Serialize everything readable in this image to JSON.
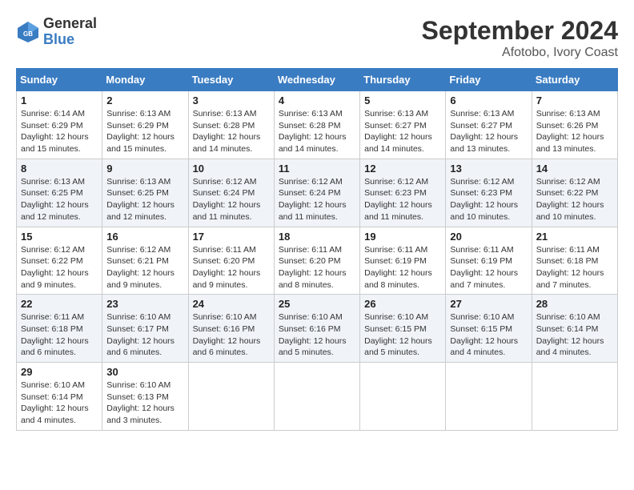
{
  "header": {
    "logo_line1": "General",
    "logo_line2": "Blue",
    "month": "September 2024",
    "location": "Afotobo, Ivory Coast"
  },
  "weekdays": [
    "Sunday",
    "Monday",
    "Tuesday",
    "Wednesday",
    "Thursday",
    "Friday",
    "Saturday"
  ],
  "weeks": [
    [
      {
        "day": "1",
        "info": "Sunrise: 6:14 AM\nSunset: 6:29 PM\nDaylight: 12 hours\nand 15 minutes."
      },
      {
        "day": "2",
        "info": "Sunrise: 6:13 AM\nSunset: 6:29 PM\nDaylight: 12 hours\nand 15 minutes."
      },
      {
        "day": "3",
        "info": "Sunrise: 6:13 AM\nSunset: 6:28 PM\nDaylight: 12 hours\nand 14 minutes."
      },
      {
        "day": "4",
        "info": "Sunrise: 6:13 AM\nSunset: 6:28 PM\nDaylight: 12 hours\nand 14 minutes."
      },
      {
        "day": "5",
        "info": "Sunrise: 6:13 AM\nSunset: 6:27 PM\nDaylight: 12 hours\nand 14 minutes."
      },
      {
        "day": "6",
        "info": "Sunrise: 6:13 AM\nSunset: 6:27 PM\nDaylight: 12 hours\nand 13 minutes."
      },
      {
        "day": "7",
        "info": "Sunrise: 6:13 AM\nSunset: 6:26 PM\nDaylight: 12 hours\nand 13 minutes."
      }
    ],
    [
      {
        "day": "8",
        "info": "Sunrise: 6:13 AM\nSunset: 6:25 PM\nDaylight: 12 hours\nand 12 minutes."
      },
      {
        "day": "9",
        "info": "Sunrise: 6:13 AM\nSunset: 6:25 PM\nDaylight: 12 hours\nand 12 minutes."
      },
      {
        "day": "10",
        "info": "Sunrise: 6:12 AM\nSunset: 6:24 PM\nDaylight: 12 hours\nand 11 minutes."
      },
      {
        "day": "11",
        "info": "Sunrise: 6:12 AM\nSunset: 6:24 PM\nDaylight: 12 hours\nand 11 minutes."
      },
      {
        "day": "12",
        "info": "Sunrise: 6:12 AM\nSunset: 6:23 PM\nDaylight: 12 hours\nand 11 minutes."
      },
      {
        "day": "13",
        "info": "Sunrise: 6:12 AM\nSunset: 6:23 PM\nDaylight: 12 hours\nand 10 minutes."
      },
      {
        "day": "14",
        "info": "Sunrise: 6:12 AM\nSunset: 6:22 PM\nDaylight: 12 hours\nand 10 minutes."
      }
    ],
    [
      {
        "day": "15",
        "info": "Sunrise: 6:12 AM\nSunset: 6:22 PM\nDaylight: 12 hours\nand 9 minutes."
      },
      {
        "day": "16",
        "info": "Sunrise: 6:12 AM\nSunset: 6:21 PM\nDaylight: 12 hours\nand 9 minutes."
      },
      {
        "day": "17",
        "info": "Sunrise: 6:11 AM\nSunset: 6:20 PM\nDaylight: 12 hours\nand 9 minutes."
      },
      {
        "day": "18",
        "info": "Sunrise: 6:11 AM\nSunset: 6:20 PM\nDaylight: 12 hours\nand 8 minutes."
      },
      {
        "day": "19",
        "info": "Sunrise: 6:11 AM\nSunset: 6:19 PM\nDaylight: 12 hours\nand 8 minutes."
      },
      {
        "day": "20",
        "info": "Sunrise: 6:11 AM\nSunset: 6:19 PM\nDaylight: 12 hours\nand 7 minutes."
      },
      {
        "day": "21",
        "info": "Sunrise: 6:11 AM\nSunset: 6:18 PM\nDaylight: 12 hours\nand 7 minutes."
      }
    ],
    [
      {
        "day": "22",
        "info": "Sunrise: 6:11 AM\nSunset: 6:18 PM\nDaylight: 12 hours\nand 6 minutes."
      },
      {
        "day": "23",
        "info": "Sunrise: 6:10 AM\nSunset: 6:17 PM\nDaylight: 12 hours\nand 6 minutes."
      },
      {
        "day": "24",
        "info": "Sunrise: 6:10 AM\nSunset: 6:16 PM\nDaylight: 12 hours\nand 6 minutes."
      },
      {
        "day": "25",
        "info": "Sunrise: 6:10 AM\nSunset: 6:16 PM\nDaylight: 12 hours\nand 5 minutes."
      },
      {
        "day": "26",
        "info": "Sunrise: 6:10 AM\nSunset: 6:15 PM\nDaylight: 12 hours\nand 5 minutes."
      },
      {
        "day": "27",
        "info": "Sunrise: 6:10 AM\nSunset: 6:15 PM\nDaylight: 12 hours\nand 4 minutes."
      },
      {
        "day": "28",
        "info": "Sunrise: 6:10 AM\nSunset: 6:14 PM\nDaylight: 12 hours\nand 4 minutes."
      }
    ],
    [
      {
        "day": "29",
        "info": "Sunrise: 6:10 AM\nSunset: 6:14 PM\nDaylight: 12 hours\nand 4 minutes."
      },
      {
        "day": "30",
        "info": "Sunrise: 6:10 AM\nSunset: 6:13 PM\nDaylight: 12 hours\nand 3 minutes."
      },
      {
        "day": "",
        "info": ""
      },
      {
        "day": "",
        "info": ""
      },
      {
        "day": "",
        "info": ""
      },
      {
        "day": "",
        "info": ""
      },
      {
        "day": "",
        "info": ""
      }
    ]
  ]
}
